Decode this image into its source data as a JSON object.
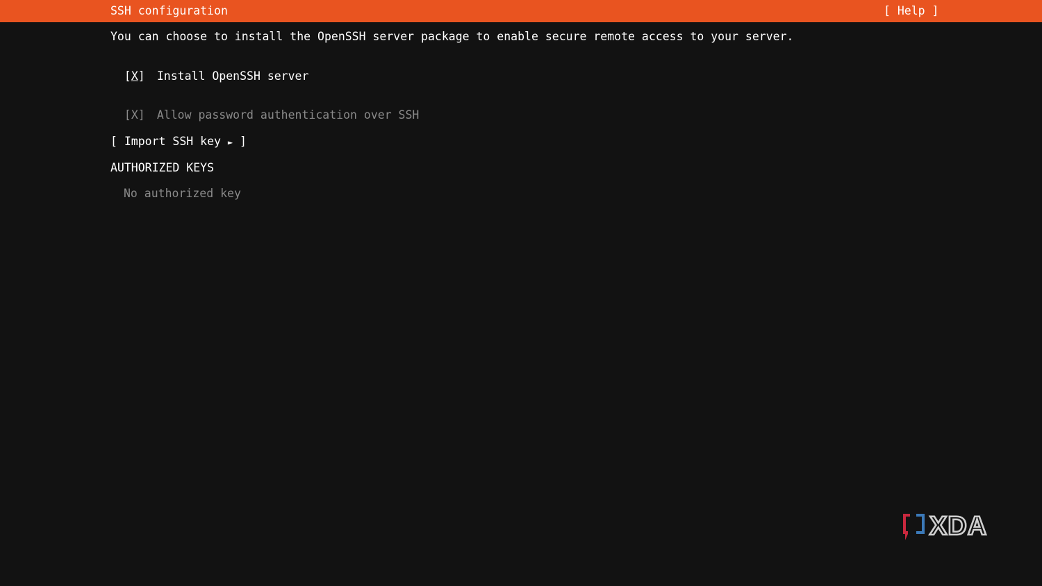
{
  "header": {
    "title": "SSH configuration",
    "help_label": "[ Help ]"
  },
  "description": "You can choose to install the OpenSSH server package to enable secure remote access to your server.",
  "options": [
    {
      "checkbox_open": "[",
      "checkbox_mark": "X",
      "checkbox_close": "]",
      "label": "Install OpenSSH server",
      "checked": true,
      "enabled": true
    },
    {
      "checkbox_open": "[",
      "checkbox_mark": "X",
      "checkbox_close": "]",
      "label": "Allow password authentication over SSH",
      "checked": true,
      "enabled": false
    }
  ],
  "import_button": {
    "label": "[ Import SSH key ",
    "arrow": "►",
    "close": " ]"
  },
  "authorized_keys": {
    "heading": "AUTHORIZED KEYS",
    "empty_text": "No authorized key"
  },
  "watermark": {
    "text": "XDA",
    "icon": "xda-bracket-icon"
  },
  "colors": {
    "accent": "#e95420",
    "background": "#121212",
    "text": "#ffffff",
    "muted_text": "#8a8a8a",
    "logo_red": "#c9283e",
    "logo_blue": "#3b79b8"
  }
}
